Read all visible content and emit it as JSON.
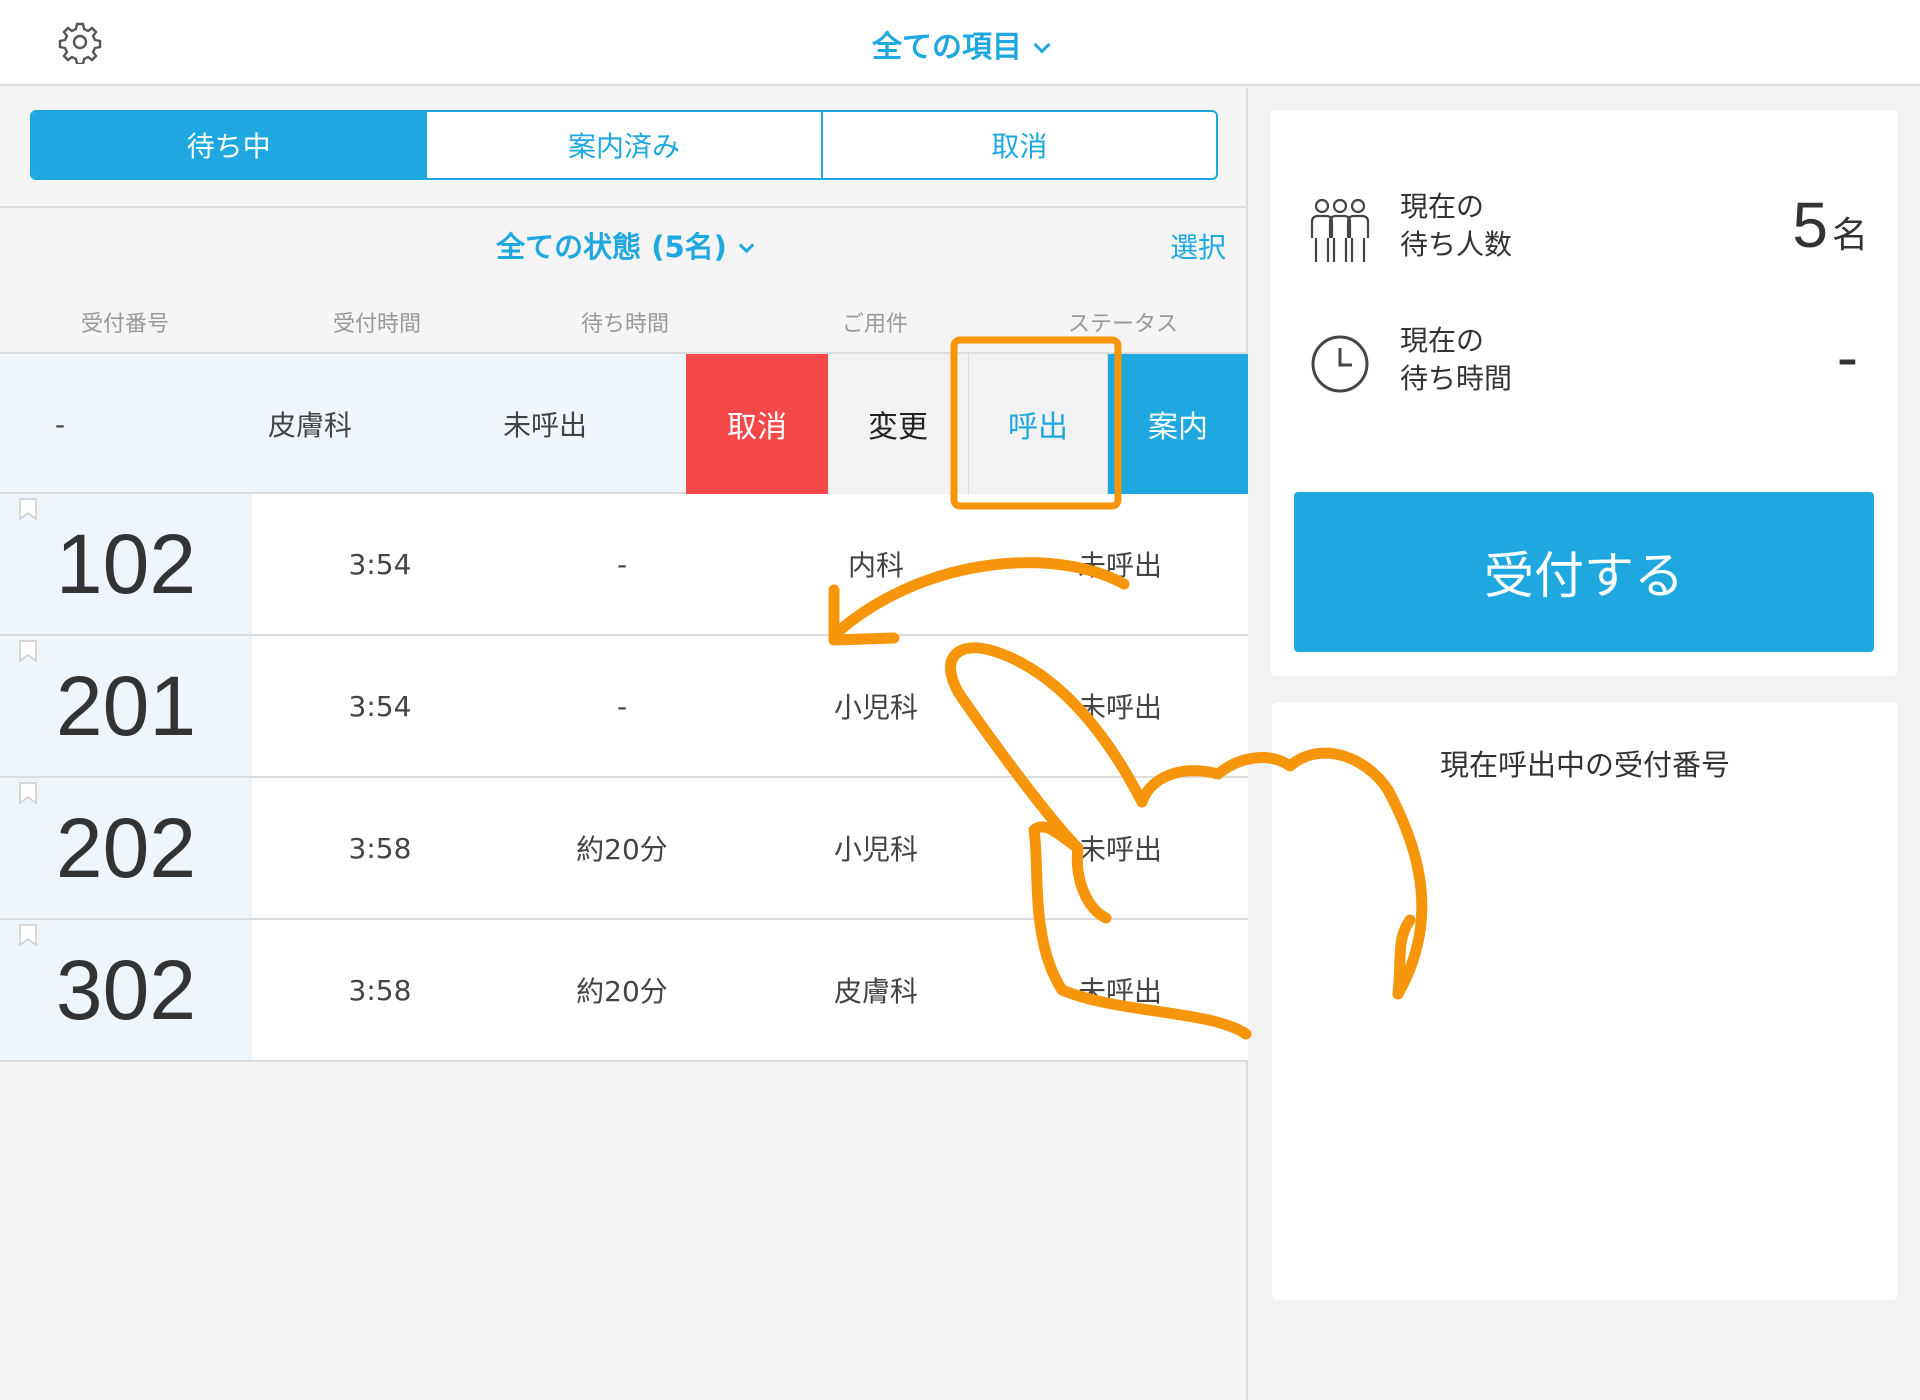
{
  "header": {
    "title": "全ての項目",
    "settings_icon": "gear-icon"
  },
  "tabs": [
    {
      "label": "待ち中",
      "active": true
    },
    {
      "label": "案内済み",
      "active": false
    },
    {
      "label": "取消",
      "active": false
    }
  ],
  "filter": {
    "label": "全ての状態 (5名)",
    "select_label": "選択"
  },
  "columns": [
    "受付番号",
    "受付時間",
    "待ち時間",
    "ご用件",
    "ステータス"
  ],
  "swiped_row": {
    "wait": "-",
    "purpose": "皮膚科",
    "status": "未呼出",
    "actions": {
      "cancel": "取消",
      "change": "変更",
      "call": "呼出",
      "guide": "案内"
    }
  },
  "rows": [
    {
      "number": "102",
      "time": "3:54",
      "wait": "-",
      "purpose": "内科",
      "status": "未呼出"
    },
    {
      "number": "201",
      "time": "3:54",
      "wait": "-",
      "purpose": "小児科",
      "status": "未呼出"
    },
    {
      "number": "202",
      "time": "3:58",
      "wait": "約20分",
      "purpose": "小児科",
      "status": "未呼出"
    },
    {
      "number": "302",
      "time": "3:58",
      "wait": "約20分",
      "purpose": "皮膚科",
      "status": "未呼出"
    }
  ],
  "stats": {
    "waiting_people_label_1": "現在の",
    "waiting_people_label_2": "待ち人数",
    "waiting_people_value": "5",
    "waiting_people_unit": "名",
    "waiting_time_label_1": "現在の",
    "waiting_time_label_2": "待ち時間",
    "waiting_time_value": "-"
  },
  "reception_button": "受付する",
  "calling": {
    "title": "現在呼出中の受付番号"
  },
  "colors": {
    "accent": "#1fa8df",
    "danger": "#f54848",
    "annotation": "#f7960a"
  }
}
